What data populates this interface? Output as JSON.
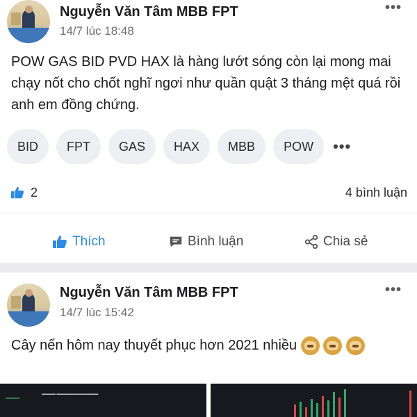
{
  "posts": [
    {
      "author": "Nguyễn Văn Tâm MBB FPT",
      "time": "14/7 lúc 18:48",
      "content": "POW GAS BID PVD HAX là hàng lướt sóng còn lại mong mai chạy nốt cho chốt nghĩ ngơi như quần quật 3 tháng mệt quá rồi anh em đồng chứng.",
      "tags": [
        "BID",
        "FPT",
        "GAS",
        "HAX",
        "MBB",
        "POW"
      ],
      "likes_count": "2",
      "comments_count": "4 bình luận",
      "actions": {
        "like": "Thích",
        "comment": "Bình luận",
        "share": "Chia sẻ"
      }
    },
    {
      "author": "Nguyễn Văn Tâm MBB FPT",
      "time": "14/7 lúc 15:42",
      "content": "Cây nến hôm nay thuyết phục hơn 2021 nhiều"
    }
  ],
  "icons": {
    "more": "more-horizontal-icon",
    "like": "thumbs-up-icon",
    "comment": "comment-bubble-icon",
    "share": "share-icon",
    "emoji": "see-no-evil-monkey-emoji"
  },
  "colors": {
    "accent": "#2a8be8",
    "separator": "#ececef",
    "tag_bg": "#eeeff2"
  }
}
